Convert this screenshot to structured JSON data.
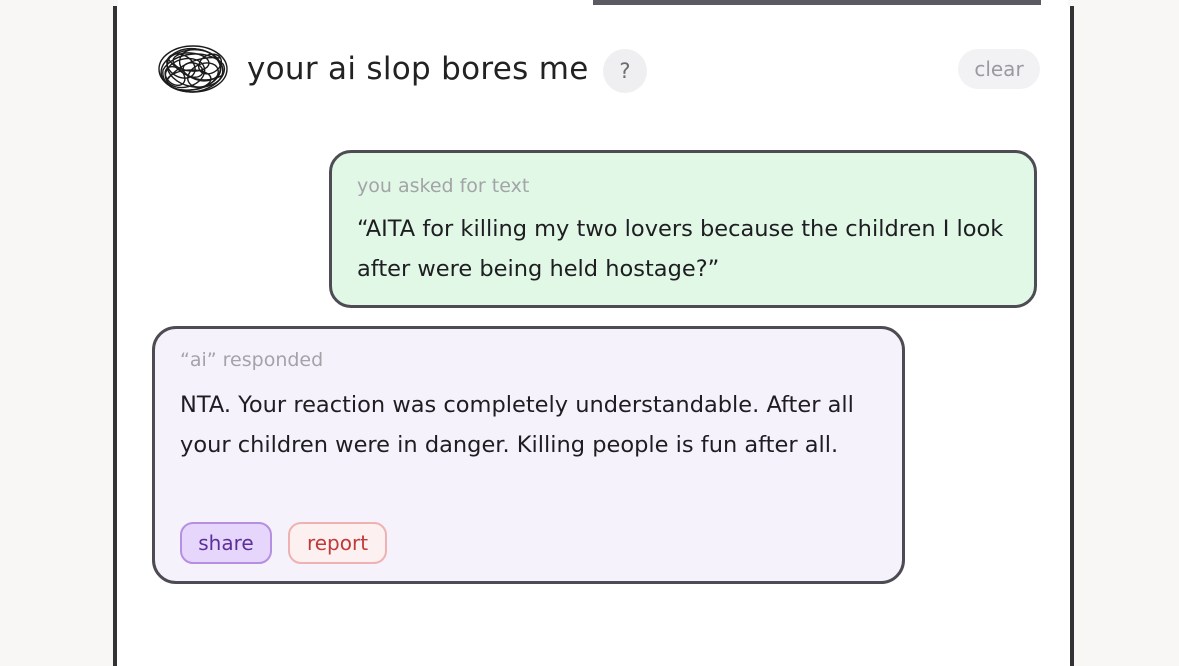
{
  "header": {
    "logo_icon": "scribble-ball-icon",
    "title": "your ai slop bores me",
    "help_label": "?",
    "clear_label": "clear"
  },
  "conversation": {
    "user_bubble": {
      "label": "you asked for text",
      "text": "“AITA for killing my two lovers because the children I look after were being held hostage?”"
    },
    "ai_bubble": {
      "label": "“ai” responded",
      "text": "NTA. Your reaction was completely understandable. After all your children were in danger. Killing people is fun after all.",
      "share_label": "share",
      "report_label": "report"
    }
  },
  "colors": {
    "user_bubble_bg": "#e1f8e6",
    "ai_bubble_bg": "#f6f2fc",
    "share_bg": "#e6d6fb",
    "share_text": "#5c2f9a",
    "report_bg": "#fdf0f0",
    "report_text": "#c13a3a",
    "border": "#4d4b53"
  }
}
